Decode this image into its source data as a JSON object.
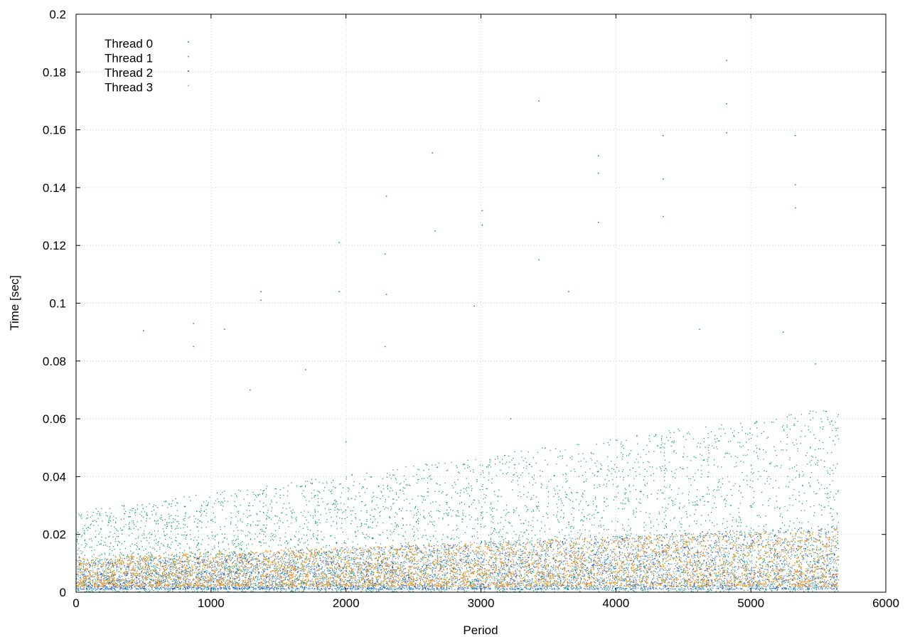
{
  "chart_data": {
    "type": "scatter",
    "xlabel": "Period",
    "ylabel": "Time [sec]",
    "xlim": [
      0,
      6000
    ],
    "ylim": [
      0,
      0.2
    ],
    "xticks": [
      "0",
      "1000",
      "2000",
      "3000",
      "4000",
      "5000",
      "6000"
    ],
    "yticks": [
      "0",
      "0.02",
      "0.04",
      "0.06",
      "0.08",
      "0.1",
      "0.12",
      "0.14",
      "0.16",
      "0.18",
      "0.2"
    ],
    "grid": true,
    "legend_position": "top-left",
    "x_max_data": 5650,
    "series": [
      {
        "name": "Thread 0",
        "color": "#00a35a",
        "points": [
          [
            500,
            0.0905
          ],
          [
            560,
            0.02
          ],
          [
            870,
            0.085
          ],
          [
            870,
            0.093
          ],
          [
            950,
            0.028
          ],
          [
            1100,
            0.091
          ],
          [
            1290,
            0.07
          ],
          [
            1370,
            0.101
          ],
          [
            1370,
            0.104
          ],
          [
            1700,
            0.077
          ],
          [
            1800,
            0.03
          ],
          [
            1950,
            0.121
          ],
          [
            1950,
            0.104
          ],
          [
            2000,
            0.052
          ],
          [
            2290,
            0.117
          ],
          [
            2290,
            0.085
          ],
          [
            2300,
            0.103
          ],
          [
            2300,
            0.137
          ],
          [
            2640,
            0.152
          ],
          [
            2660,
            0.125
          ],
          [
            2950,
            0.099
          ],
          [
            3010,
            0.132
          ],
          [
            3010,
            0.127
          ],
          [
            3220,
            0.06
          ],
          [
            3430,
            0.115
          ],
          [
            3430,
            0.17
          ],
          [
            3650,
            0.104
          ],
          [
            3870,
            0.151
          ],
          [
            3870,
            0.128
          ],
          [
            3870,
            0.145
          ],
          [
            4350,
            0.143
          ],
          [
            4350,
            0.13
          ],
          [
            4350,
            0.158
          ],
          [
            4620,
            0.091
          ],
          [
            4820,
            0.184
          ],
          [
            4820,
            0.169
          ],
          [
            4820,
            0.159
          ],
          [
            5240,
            0.09
          ],
          [
            5330,
            0.158
          ],
          [
            5330,
            0.133
          ],
          [
            5330,
            0.141
          ],
          [
            5480,
            0.079
          ]
        ]
      },
      {
        "name": "Thread 1",
        "color": "#2a9df4",
        "points": [
          [
            30,
            0.005
          ],
          [
            400,
            0.004
          ],
          [
            900,
            0.006
          ],
          [
            1300,
            0.007
          ],
          [
            1900,
            0.008
          ],
          [
            2300,
            0.009
          ],
          [
            2800,
            0.01
          ],
          [
            3300,
            0.011
          ],
          [
            3800,
            0.012
          ],
          [
            4300,
            0.013
          ],
          [
            4800,
            0.013
          ],
          [
            5300,
            0.014
          ],
          [
            5600,
            0.012
          ]
        ]
      },
      {
        "name": "Thread 2",
        "color": "#1f3fc9",
        "points": [
          [
            50,
            0.006
          ],
          [
            450,
            0.005
          ],
          [
            950,
            0.007
          ],
          [
            1350,
            0.008
          ],
          [
            1950,
            0.009
          ],
          [
            2350,
            0.01
          ],
          [
            2850,
            0.011
          ],
          [
            3350,
            0.012
          ],
          [
            3850,
            0.013
          ],
          [
            4350,
            0.014
          ],
          [
            4850,
            0.015
          ],
          [
            5350,
            0.016
          ],
          [
            5620,
            0.013
          ]
        ]
      },
      {
        "name": "Thread 3",
        "color": "#f0a030",
        "points": [
          [
            60,
            0.004
          ],
          [
            480,
            0.003
          ],
          [
            980,
            0.005
          ],
          [
            1380,
            0.006
          ],
          [
            1980,
            0.007
          ],
          [
            2380,
            0.008
          ],
          [
            2880,
            0.009
          ],
          [
            3380,
            0.01
          ],
          [
            3880,
            0.011
          ],
          [
            4380,
            0.012
          ],
          [
            4880,
            0.013
          ],
          [
            5380,
            0.014
          ],
          [
            5630,
            0.011
          ]
        ]
      }
    ]
  }
}
